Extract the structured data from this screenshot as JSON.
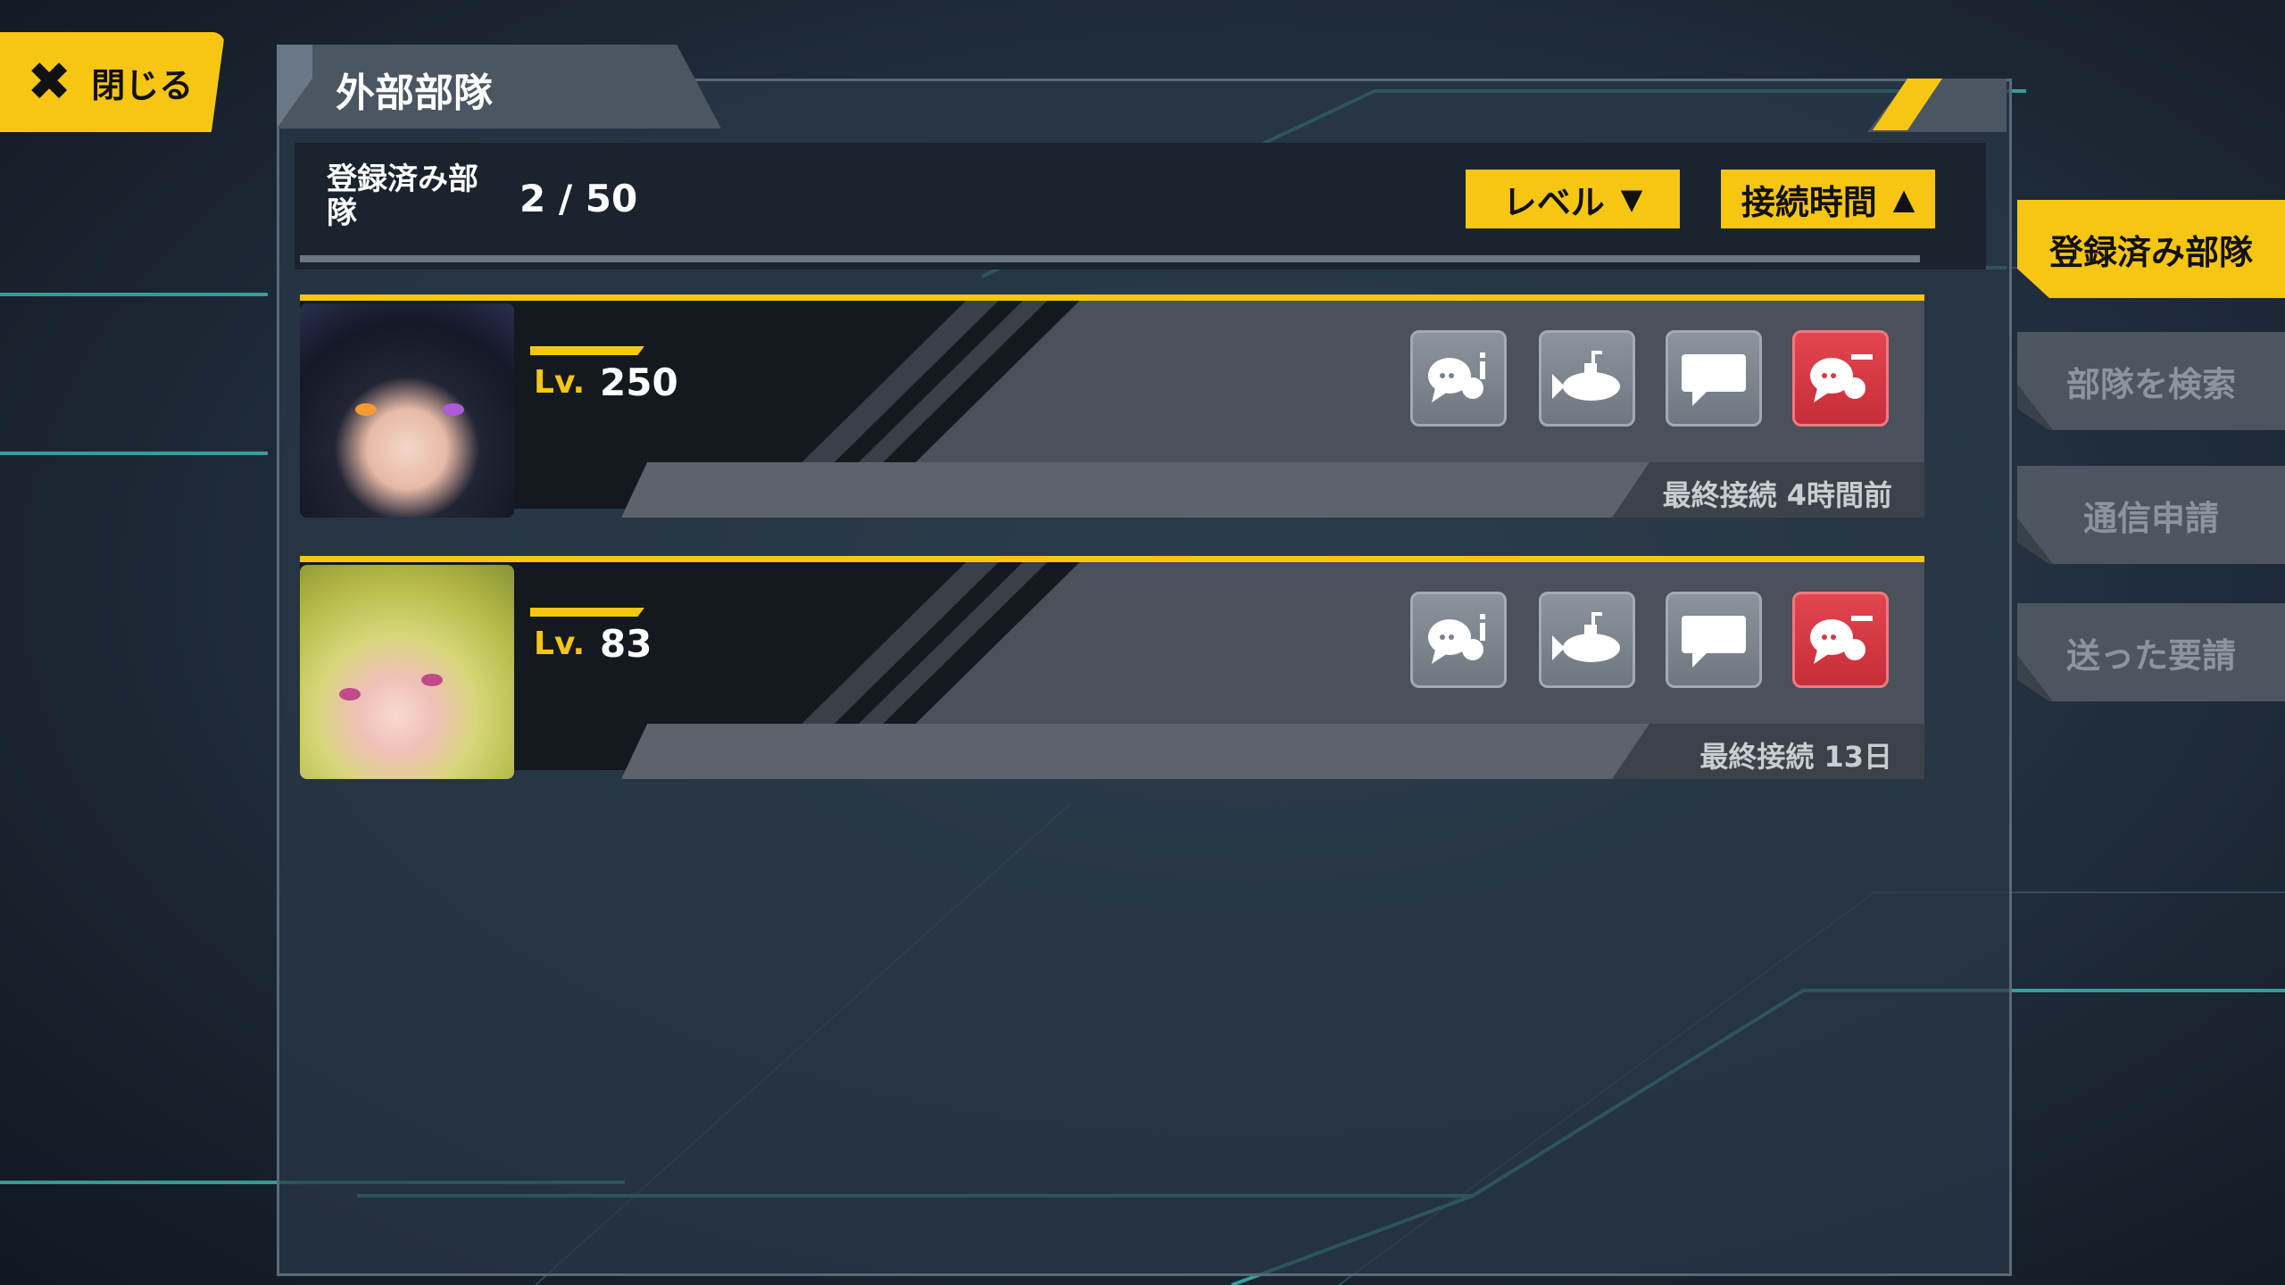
{
  "close_button": {
    "label": "閉じる"
  },
  "panel": {
    "title": "外部部隊"
  },
  "header": {
    "registered_label": "登録済み部隊",
    "registered_count": "2 / 50",
    "sort_level": "レベル",
    "sort_time": "接続時間"
  },
  "rows": [
    {
      "level_label": "Lv.",
      "level": "250",
      "last_login": "最終接続 4時間前"
    },
    {
      "level_label": "Lv.",
      "level": "83",
      "last_login": "最終接続 13日"
    }
  ],
  "side_tabs": [
    {
      "label": "登録済み部隊",
      "active": true
    },
    {
      "label": "部隊を検索",
      "active": false
    },
    {
      "label": "通信申請",
      "active": false
    },
    {
      "label": "送った要請",
      "active": false
    }
  ],
  "icons": {
    "close": "close-icon",
    "sort_down": "triangle-down-icon",
    "sort_up": "triangle-up-icon",
    "actions": [
      "chat-info-icon",
      "submarine-icon",
      "message-icon",
      "chat-remove-icon"
    ]
  },
  "colors": {
    "accent": "#f6c613",
    "danger": "#d63a44",
    "panel": "#2a3846"
  }
}
